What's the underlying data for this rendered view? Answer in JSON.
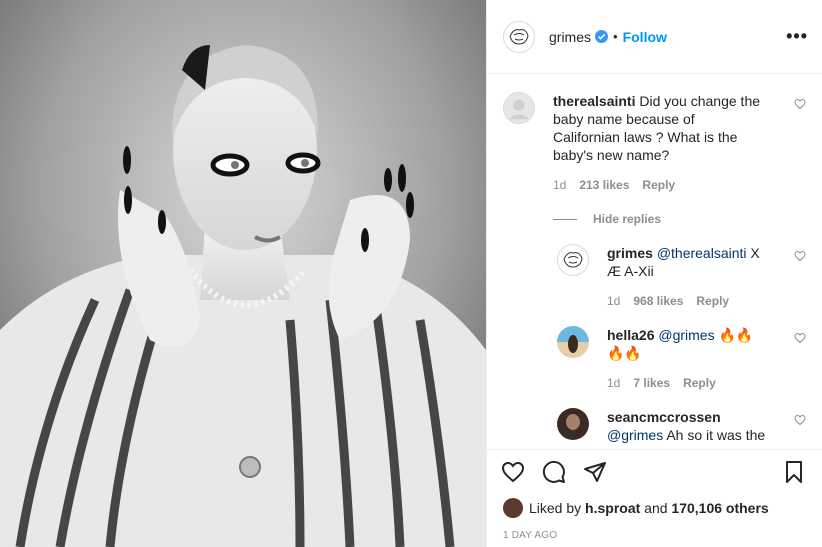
{
  "header": {
    "username": "grimes",
    "dot": "•",
    "follow_label": "Follow",
    "more_label": "•••"
  },
  "comments": [
    {
      "username": "therealsainti",
      "text": "Did you change the baby name because of Californian laws ? What is the baby's new name?",
      "time": "1d",
      "likes": "213 likes",
      "reply": "Reply"
    }
  ],
  "hide_replies_label": "Hide replies",
  "replies": [
    {
      "username": "grimes",
      "mention": "@therealsainti",
      "text": " X Æ A-Xii",
      "time": "1d",
      "likes": "968 likes",
      "reply": "Reply",
      "avatar": "sketch"
    },
    {
      "username": "hella26",
      "mention": "@grimes",
      "text": " 🔥🔥🔥🔥",
      "time": "1d",
      "likes": "7 likes",
      "reply": "Reply",
      "avatar": "beach"
    },
    {
      "username": "seancmccrossen",
      "mention": "@grimes",
      "text": " Ah so it was the",
      "time": "",
      "likes": "",
      "reply": "",
      "avatar": "dark"
    }
  ],
  "likes": {
    "prefix": "Liked by",
    "user": "h.sproat",
    "and": "and",
    "count": "170,106 others"
  },
  "date": "1 DAY AGO",
  "colors": {
    "accent": "#0095f6",
    "muted": "#8e8e8e",
    "text": "#262626",
    "mention": "#00376b"
  },
  "icons": {
    "heart": "heart-icon",
    "comment": "comment-icon",
    "share": "share-icon",
    "bookmark": "bookmark-icon",
    "verified": "verified-badge-icon",
    "more": "more-options-icon"
  }
}
